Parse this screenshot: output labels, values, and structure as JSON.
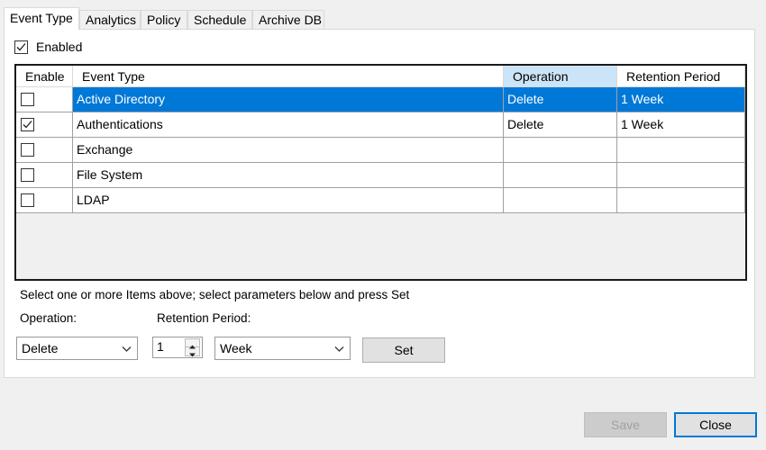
{
  "tabs": [
    {
      "label": "Event Type",
      "active": true
    },
    {
      "label": "Analytics"
    },
    {
      "label": "Policy"
    },
    {
      "label": "Schedule"
    },
    {
      "label": "Archive DB"
    }
  ],
  "enabled": {
    "label": "Enabled",
    "checked": true
  },
  "grid": {
    "headers": {
      "enable": "Enable",
      "event_type": "Event Type",
      "operation": "Operation",
      "retention": "Retention Period"
    },
    "rows": [
      {
        "checked": false,
        "event_type": "Active Directory",
        "operation": "Delete",
        "retention": "1 Week",
        "selected": true
      },
      {
        "checked": true,
        "event_type": "Authentications",
        "operation": "Delete",
        "retention": "1 Week",
        "selected": false
      },
      {
        "checked": false,
        "event_type": "Exchange",
        "operation": "",
        "retention": "",
        "selected": false
      },
      {
        "checked": false,
        "event_type": "File System",
        "operation": "",
        "retention": "",
        "selected": false
      },
      {
        "checked": false,
        "event_type": "LDAP",
        "operation": "",
        "retention": "",
        "selected": false
      }
    ]
  },
  "hint": "Select one or more Items above; select parameters below and press Set",
  "params": {
    "operation_label": "Operation:",
    "retention_label": "Retention Period:",
    "operation_value": "Delete",
    "retention_number": "1",
    "retention_unit": "Week",
    "set_label": "Set"
  },
  "footer": {
    "save_label": "Save",
    "close_label": "Close"
  },
  "colors": {
    "selection": "#0078d7",
    "header_selected": "#cce4f7"
  }
}
